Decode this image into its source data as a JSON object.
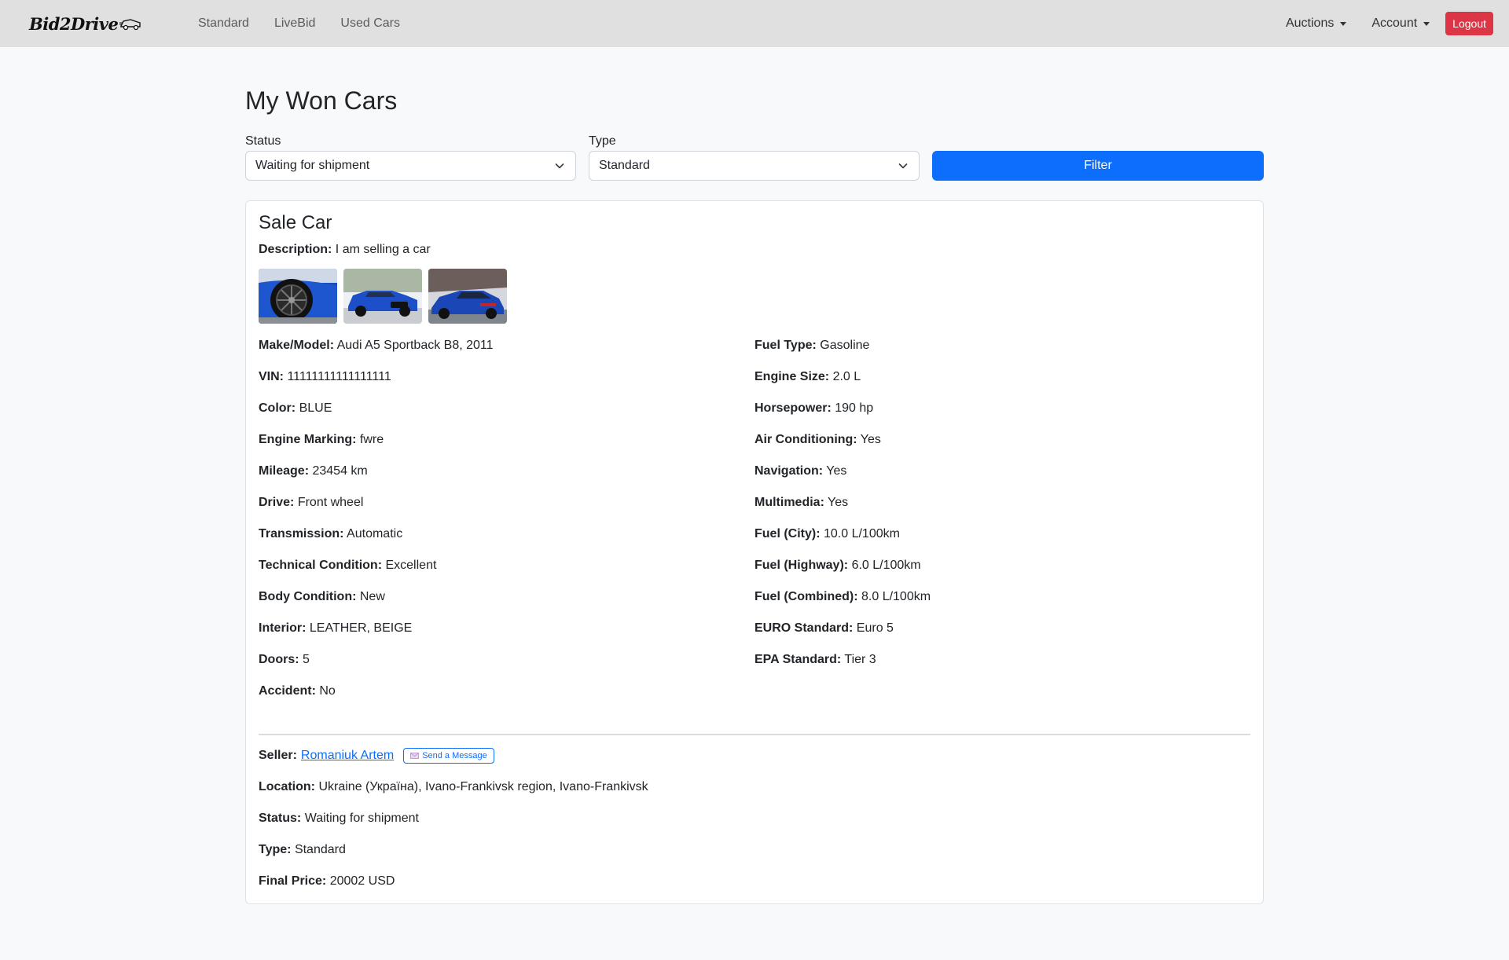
{
  "brand": {
    "name": "Bid2Drive"
  },
  "nav": {
    "links": [
      "Standard",
      "LiveBid",
      "Used Cars"
    ],
    "auctions": "Auctions",
    "account": "Account",
    "logout": "Logout"
  },
  "page": {
    "title": "My Won Cars"
  },
  "filters": {
    "status_label": "Status",
    "status_value": "Waiting for shipment",
    "type_label": "Type",
    "type_value": "Standard",
    "filter_button": "Filter"
  },
  "listing": {
    "title": "Sale Car",
    "description_label": "Description:",
    "description": "I am selling a car",
    "images": [
      "car-wheel-photo",
      "car-front-photo",
      "car-rear-photo"
    ],
    "specs_left": [
      {
        "label": "Make/Model:",
        "value": "Audi A5 Sportback B8, 2011"
      },
      {
        "label": "VIN:",
        "value": "11111111111111111"
      },
      {
        "label": "Color:",
        "value": "BLUE"
      },
      {
        "label": "Engine Marking:",
        "value": "fwre"
      },
      {
        "label": "Mileage:",
        "value": "23454 km"
      },
      {
        "label": "Drive:",
        "value": "Front wheel"
      },
      {
        "label": "Transmission:",
        "value": "Automatic"
      },
      {
        "label": "Technical Condition:",
        "value": "Excellent"
      },
      {
        "label": "Body Condition:",
        "value": "New"
      },
      {
        "label": "Interior:",
        "value": "LEATHER, BEIGE"
      },
      {
        "label": "Doors:",
        "value": "5"
      },
      {
        "label": "Accident:",
        "value": "No"
      }
    ],
    "specs_right": [
      {
        "label": "Fuel Type:",
        "value": "Gasoline"
      },
      {
        "label": "Engine Size:",
        "value": "2.0 L"
      },
      {
        "label": "Horsepower:",
        "value": "190 hp"
      },
      {
        "label": "Air Conditioning:",
        "value": "Yes"
      },
      {
        "label": "Navigation:",
        "value": "Yes"
      },
      {
        "label": "Multimedia:",
        "value": "Yes"
      },
      {
        "label": "Fuel (City):",
        "value": "10.0 L/100km"
      },
      {
        "label": "Fuel (Highway):",
        "value": "6.0 L/100km"
      },
      {
        "label": "Fuel (Combined):",
        "value": "8.0 L/100km"
      },
      {
        "label": "EURO Standard:",
        "value": "Euro 5"
      },
      {
        "label": "EPA Standard:",
        "value": "Tier 3"
      }
    ],
    "seller_label": "Seller:",
    "seller_name": "Romaniuk Artem",
    "send_message": "Send a Message",
    "location_label": "Location:",
    "location": "Ukraine (Україна), Ivano-Frankivsk region, Ivano-Frankivsk",
    "status_label": "Status:",
    "status": "Waiting for shipment",
    "type_label": "Type:",
    "type": "Standard",
    "price_label": "Final Price:",
    "price": "20002 USD"
  },
  "colors": {
    "primary": "#0d6efd",
    "danger": "#dc3545",
    "navbar": "#e0e0e0"
  }
}
